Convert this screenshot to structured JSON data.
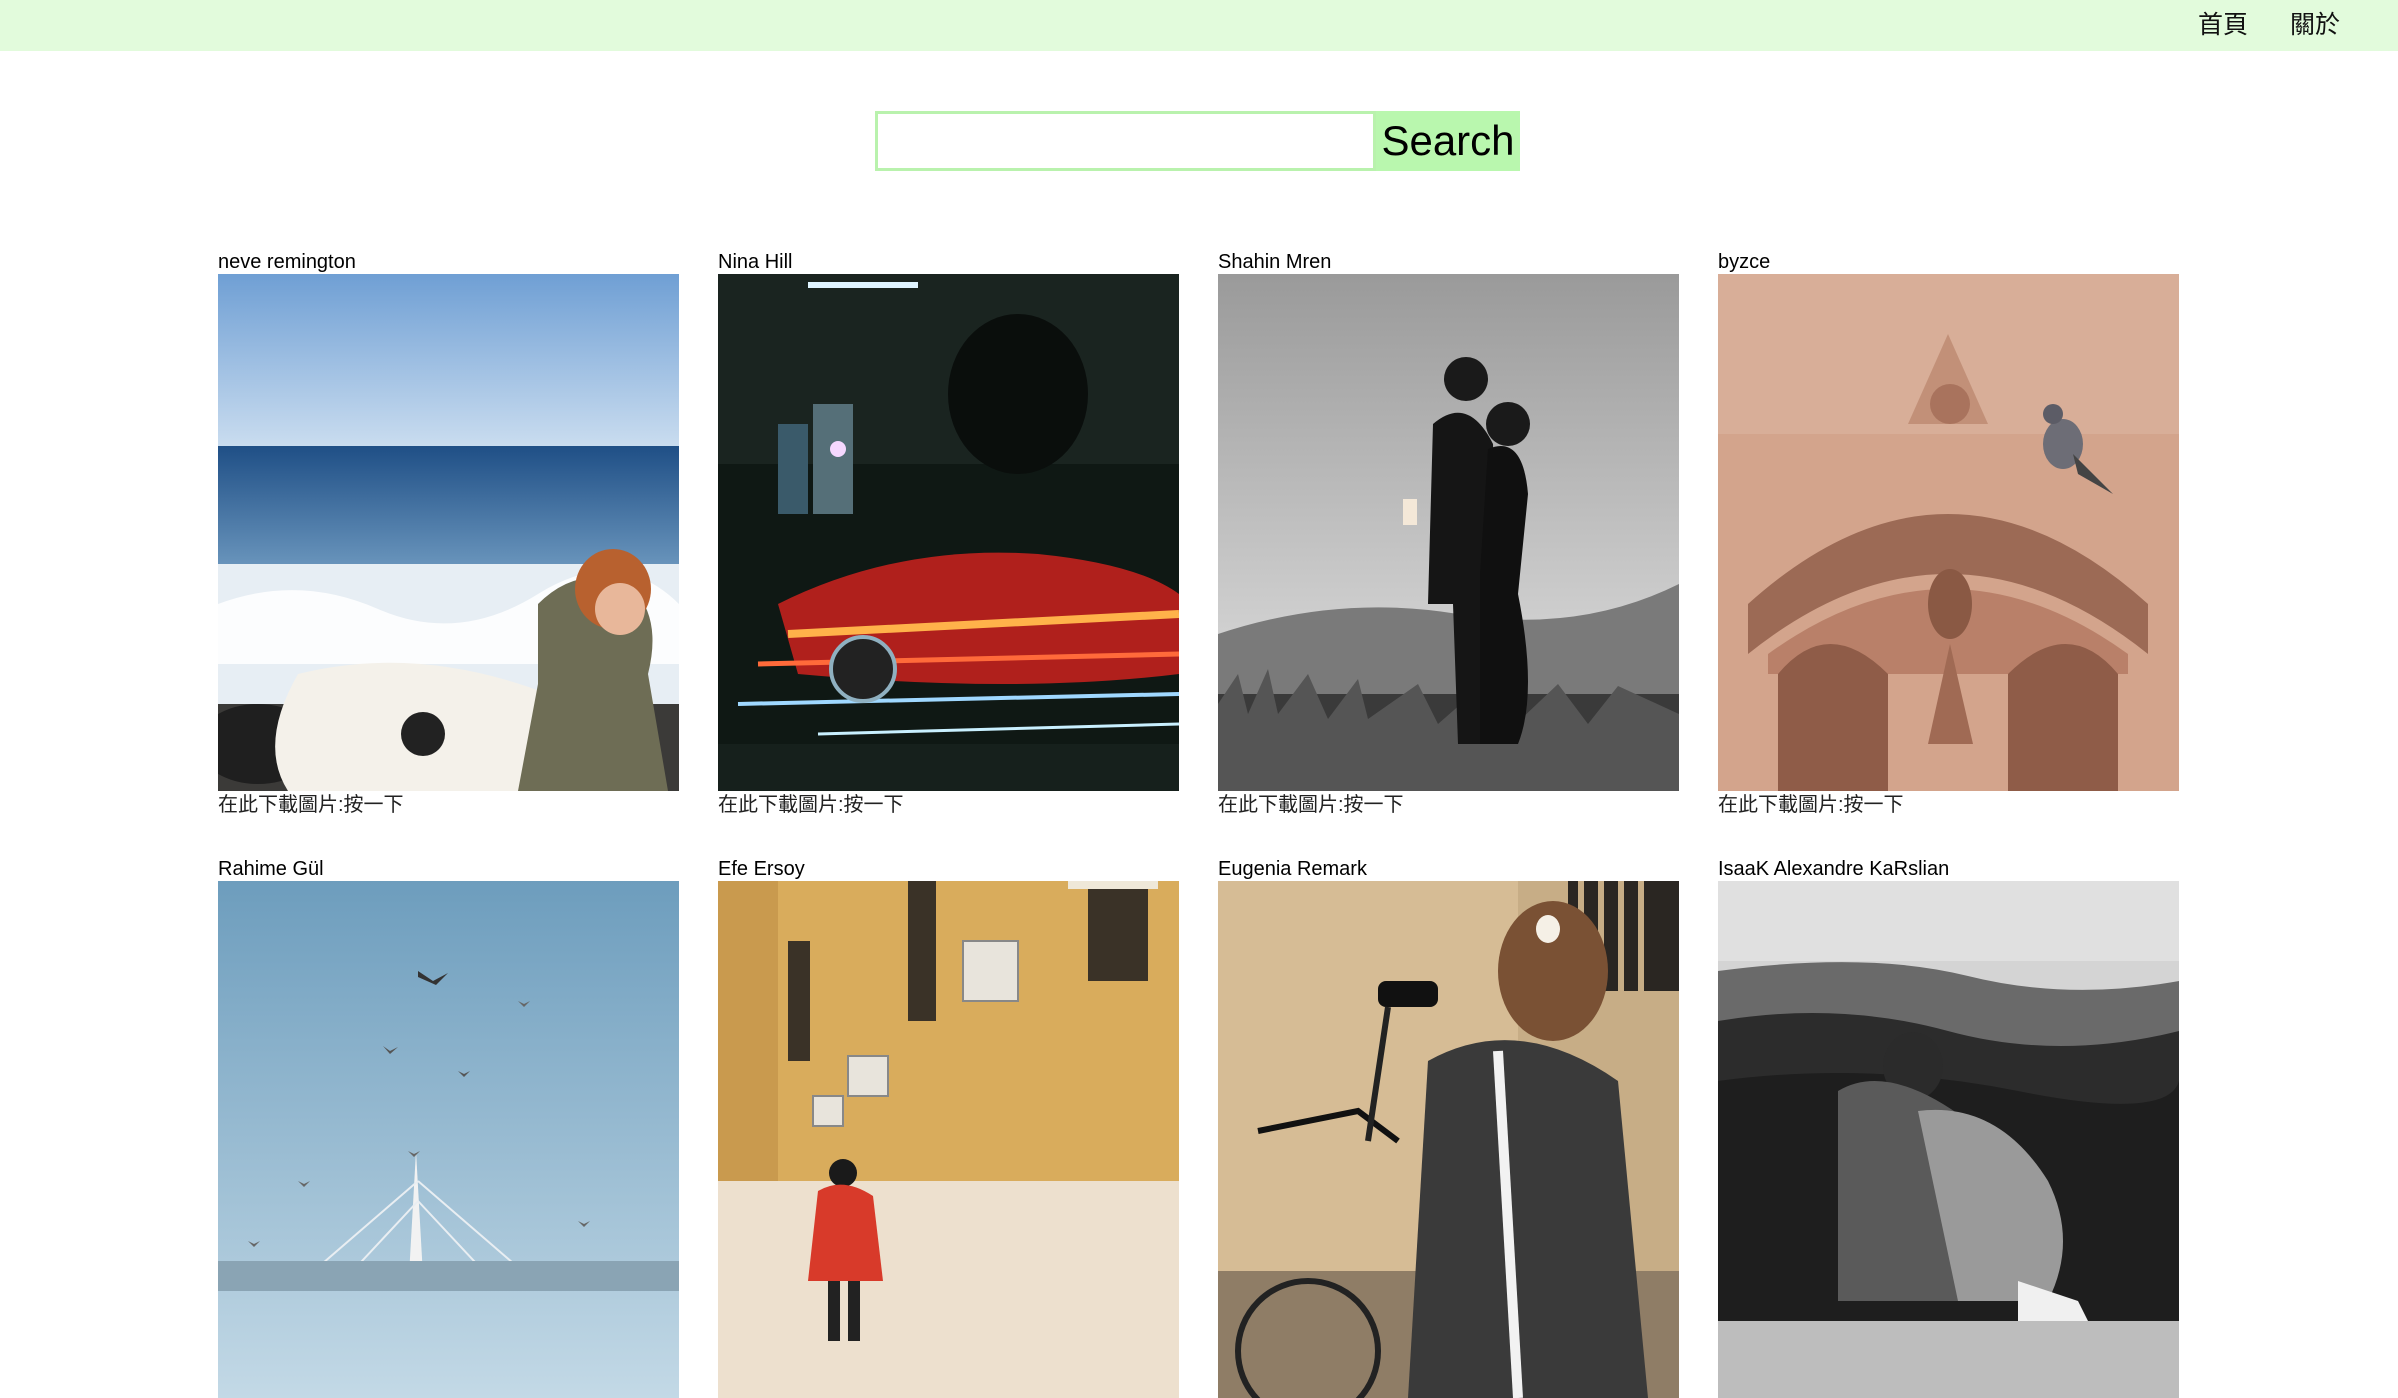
{
  "nav": {
    "home_label": "首頁",
    "about_label": "關於"
  },
  "search": {
    "placeholder": "",
    "value": "",
    "button_label": "Search"
  },
  "colors": {
    "navbar_bg": "#e2fbdc",
    "search_border": "#b9f2ad",
    "search_button_bg": "#b9f7ae"
  },
  "gallery": {
    "items": [
      {
        "author": "neve remington",
        "download_label": "在此下載圖片:按一下",
        "photo": "surfer-ocean"
      },
      {
        "author": "Nina Hill",
        "download_label": "在此下載圖片:按一下",
        "photo": "night-car-lights"
      },
      {
        "author": "Shahin Mren",
        "download_label": "在此下載圖片:按一下",
        "photo": "couple-bw"
      },
      {
        "author": "byzce",
        "download_label": "在此下載圖片:按一下",
        "photo": "carved-arch-pigeon"
      },
      {
        "author": "Rahime Gül",
        "download_label": "",
        "photo": "seagulls-tower"
      },
      {
        "author": "Efe Ersoy",
        "download_label": "",
        "photo": "yellow-building-street"
      },
      {
        "author": "Eugenia Remark",
        "download_label": "",
        "photo": "woman-bicycle"
      },
      {
        "author": "IsaaK Alexandre KaRslian",
        "download_label": "",
        "photo": "woman-cliff-bw"
      }
    ]
  }
}
